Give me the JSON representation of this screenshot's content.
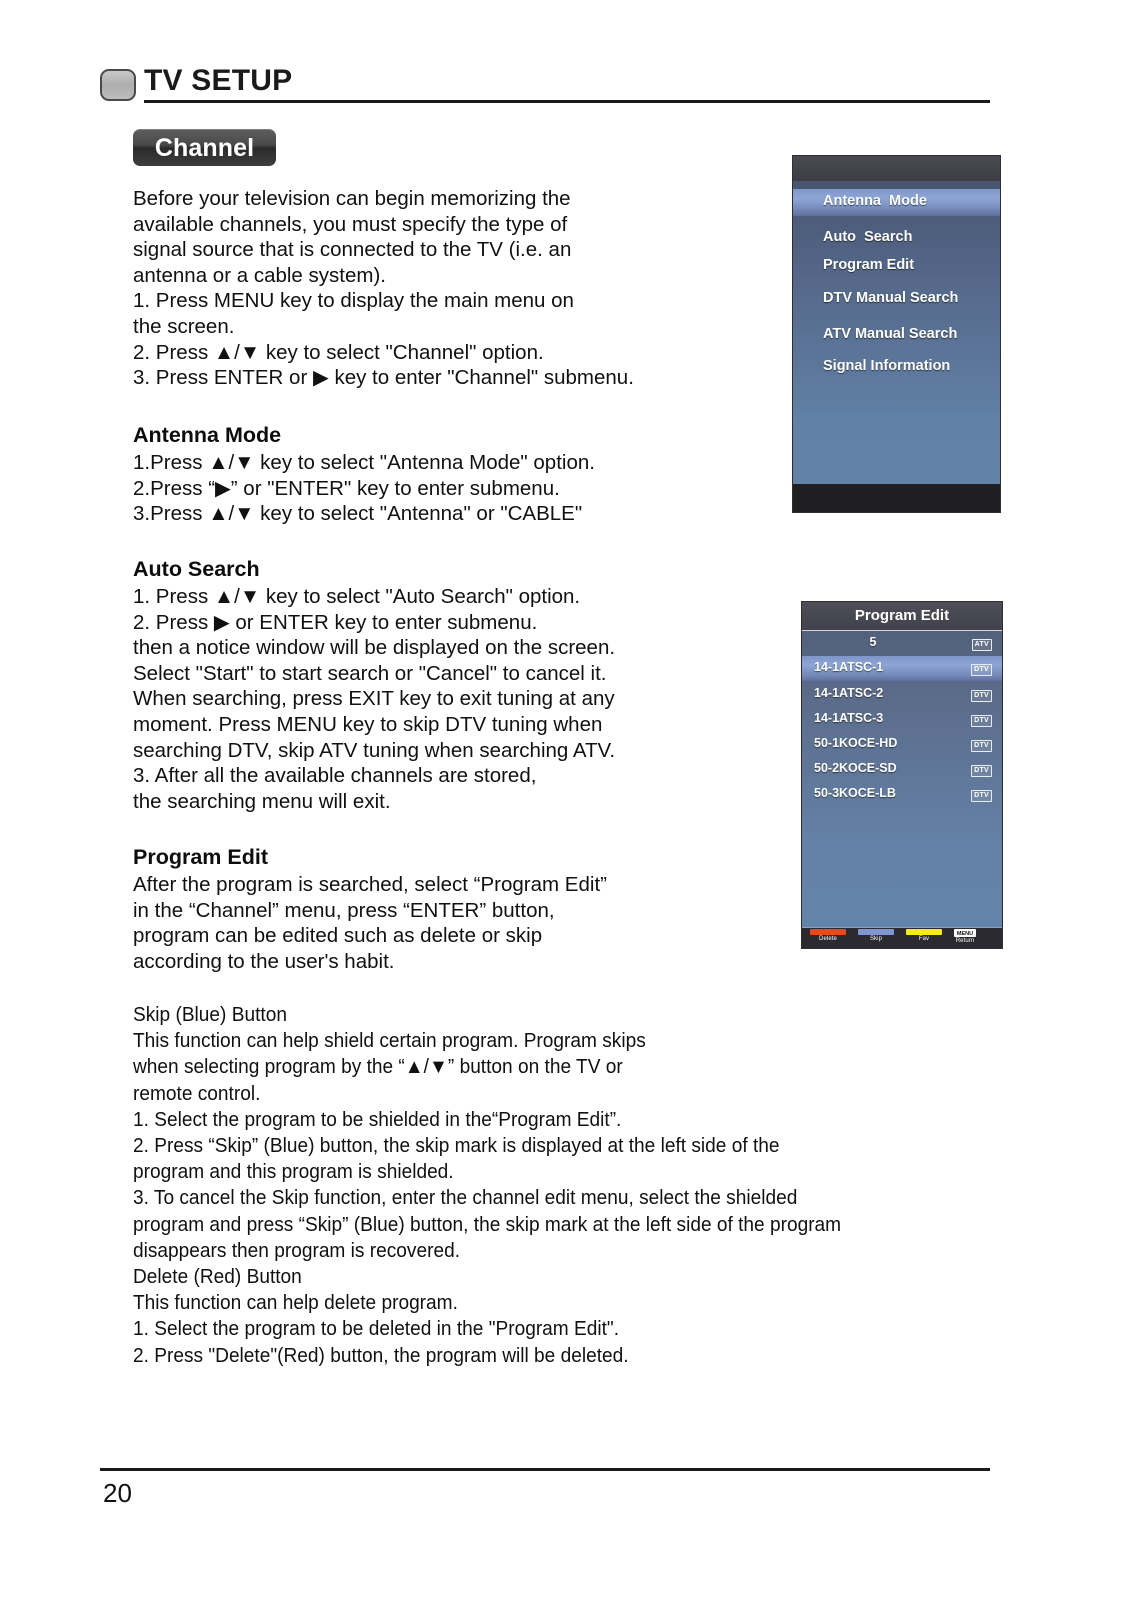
{
  "header": {
    "title": "TV SETUP"
  },
  "section_tab": {
    "label": "Channel"
  },
  "content": {
    "intro": "Before your television can begin memorizing the\navailable channels, you must specify the type of\nsignal source that is connected to the TV (i.e. an\nantenna or a cable system).\n1. Press MENU key to display the main menu on\nthe screen.\n2. Press ▲/▼ key to select \"Channel\" option.\n3. Press ENTER or ▶ key to enter \"Channel\" submenu.",
    "antenna_mode_heading": "Antenna Mode",
    "antenna_mode_body": "1.Press ▲/▼ key to select \"Antenna Mode\" option.\n2.Press “▶” or \"ENTER\" key to enter submenu.\n3.Press ▲/▼ key to select \"Antenna\" or \"CABLE\"",
    "auto_search_heading": "Auto Search",
    "auto_search_body": "1. Press ▲/▼ key to select \"Auto Search\" option.\n2. Press ▶ or ENTER key to enter submenu.\nthen a notice window will be displayed on the screen.\nSelect \"Start\" to start search or \"Cancel\" to cancel it.\nWhen searching, press EXIT key to exit tuning at any\nmoment. Press MENU key to skip DTV tuning when\nsearching DTV, skip ATV tuning when searching ATV.\n3. After all the available channels are stored,\nthe searching menu will exit.",
    "program_edit_heading": "Program Edit",
    "program_edit_body": "After the program is searched, select “Program Edit”\nin the “Channel” menu, press “ENTER” button,\nprogram can be edited such as delete or skip\naccording to the user's habit.",
    "buttons_body": "Skip (Blue) Button\nThis function can help shield certain program. Program skips\nwhen selecting program by the “▲/▼” button on the TV or\nremote control.\n1. Select the program to be shielded in the“Program Edit”.\n2. Press “Skip” (Blue) button, the skip mark is displayed at the left side of the\nprogram and this program is shielded.\n3. To cancel the Skip function, enter the channel edit menu, select the shielded\nprogram and press “Skip” (Blue) button, the skip mark at the left side of the program\ndisappears then program is recovered.\nDelete (Red) Button\nThis function can help delete program.\n1. Select the program to be deleted in the \"Program Edit\".\n2. Press \"Delete\"(Red) button, the program will be deleted."
  },
  "osd_menu": {
    "items": [
      {
        "label": "Antenna  Mode",
        "highlighted": true
      },
      {
        "label": "Auto  Search",
        "highlighted": false
      },
      {
        "label": "Program Edit",
        "highlighted": false
      },
      {
        "label": "DTV Manual Search",
        "highlighted": false
      },
      {
        "label": "ATV Manual Search",
        "highlighted": false
      },
      {
        "label": "Signal Information",
        "highlighted": false
      }
    ]
  },
  "osd_program_edit": {
    "title": "Program Edit",
    "rows": [
      {
        "name": "5",
        "badge": "ATV",
        "selected": false,
        "centered": true
      },
      {
        "name": "14-1ATSC-1",
        "badge": "DTV",
        "selected": true,
        "centered": false
      },
      {
        "name": "14-1ATSC-2",
        "badge": "DTV",
        "selected": false,
        "centered": false
      },
      {
        "name": "14-1ATSC-3",
        "badge": "DTV",
        "selected": false,
        "centered": false
      },
      {
        "name": "50-1KOCE-HD",
        "badge": "DTV",
        "selected": false,
        "centered": false
      },
      {
        "name": "50-2KOCE-SD",
        "badge": "DTV",
        "selected": false,
        "centered": false
      },
      {
        "name": "50-3KOCE-LB",
        "badge": "DTV",
        "selected": false,
        "centered": false
      }
    ],
    "function_keys": [
      {
        "label": "Delete",
        "color": "#e8491d"
      },
      {
        "label": "Skip",
        "color": "#7f96d0"
      },
      {
        "label": "Fav",
        "color": "#f5ec18"
      },
      {
        "label": "Return",
        "color": "#ffffff",
        "badge": "MENU"
      }
    ]
  },
  "footer": {
    "page_number": "20"
  }
}
